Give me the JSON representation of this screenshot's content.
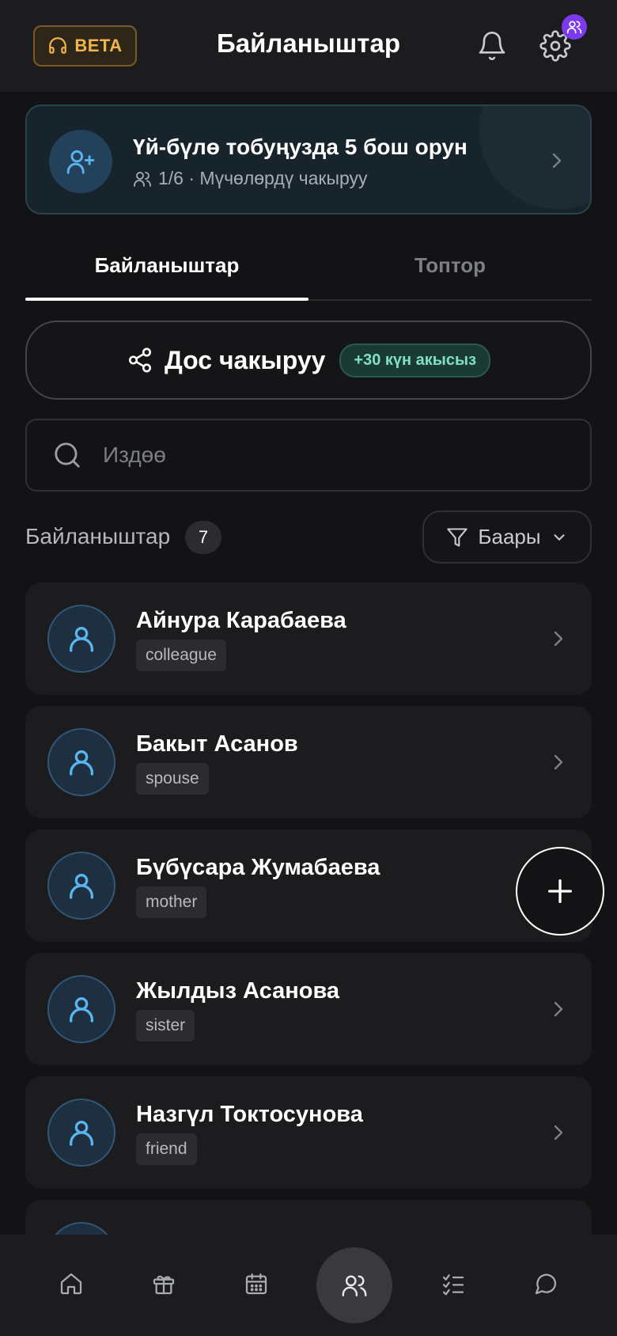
{
  "header": {
    "beta_label": "BETA",
    "title": "Байланыштар"
  },
  "family_banner": {
    "title": "Үй-бүлө тобуңузда 5 бош орун",
    "subtitle": "1/6 · Мүчөлөрдү чакыруу"
  },
  "tabs": [
    {
      "label": "Байланыштар",
      "active": true
    },
    {
      "label": "Топтор",
      "active": false
    }
  ],
  "invite": {
    "label": "Дос чакыруу",
    "bonus": "+30 күн акысыз"
  },
  "search": {
    "placeholder": "Издөө"
  },
  "contacts_section": {
    "label": "Байланыштар",
    "count": "7",
    "filter_label": "Баары"
  },
  "contacts": [
    {
      "name": "Айнура Карабаева",
      "relation": "colleague"
    },
    {
      "name": "Бакыт Асанов",
      "relation": "spouse"
    },
    {
      "name": "Бүбүсара Жумабаева",
      "relation": "mother"
    },
    {
      "name": "Жылдыз Асанова",
      "relation": "sister"
    },
    {
      "name": "Назгүл Токтосунова",
      "relation": "friend"
    }
  ],
  "bottom_nav": {
    "items": [
      "home-icon",
      "gift-icon",
      "calendar-icon",
      "contacts-icon",
      "checklist-icon",
      "chat-icon"
    ],
    "active": "contacts-icon"
  },
  "colors": {
    "background": "#131315",
    "card": "#1c1c1e",
    "accent_blue": "#5ab4f0",
    "beta_orange": "#f2b54a",
    "badge_purple": "#7c3aed",
    "bonus_green": "#7fe0c6"
  }
}
